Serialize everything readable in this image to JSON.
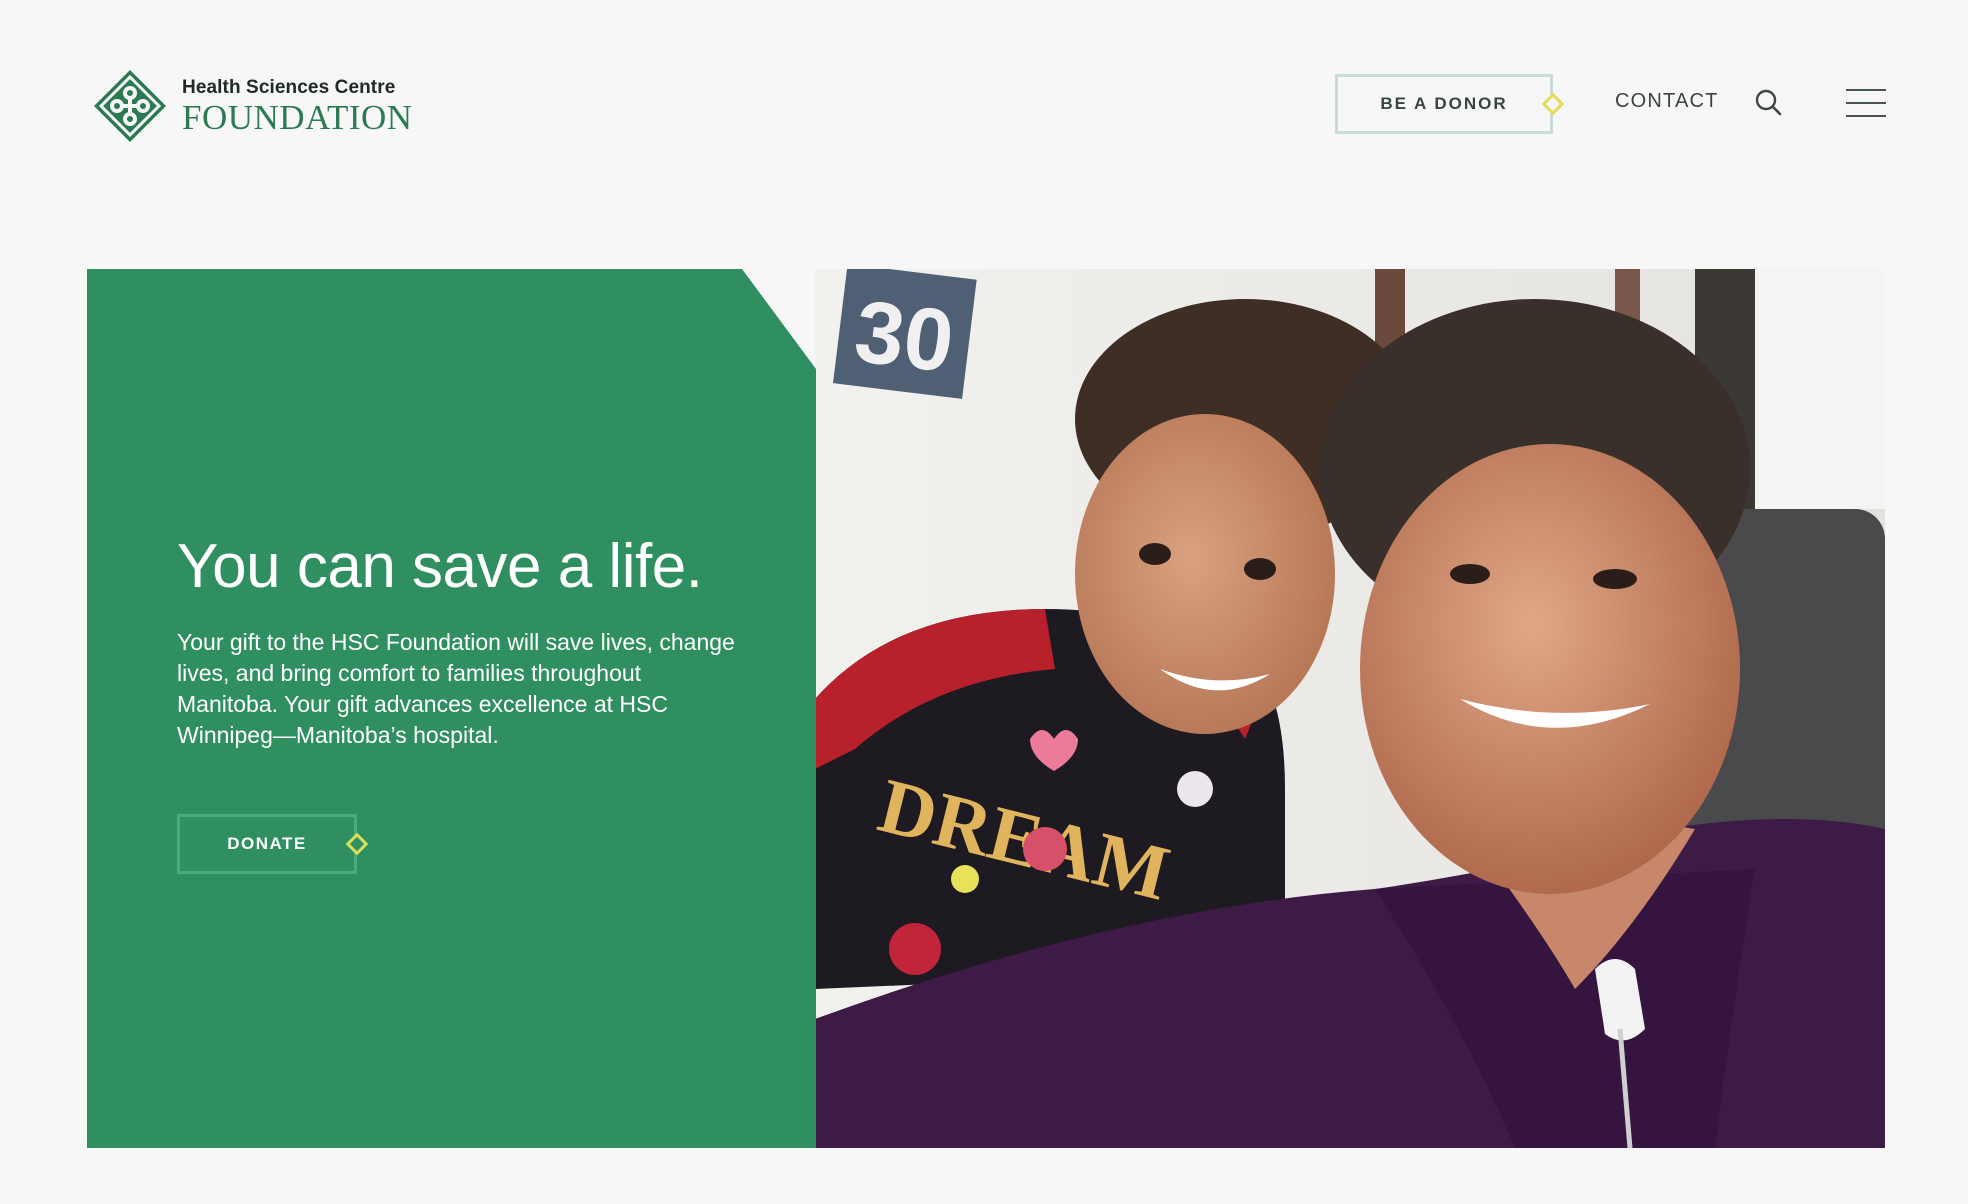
{
  "logo": {
    "line1": "Health Sciences Centre",
    "line2": "FOUNDATION",
    "icon": "hsc-foundation-logo-icon"
  },
  "nav": {
    "be_a_donor": "BE A DONOR",
    "contact": "CONTACT",
    "search_icon": "search-icon",
    "menu_icon": "hamburger-menu-icon"
  },
  "hero": {
    "heading": "You can save a life.",
    "body": "Your gift to the HSC Foundation will save lives, change lives, and bring comfort to families throughout Manitoba. Your gift advances excellence at HSC Winnipeg—Manitoba’s hospital.",
    "donate_label": "DONATE",
    "photo": {
      "number_sign": "30",
      "shirt_text": "DREAM"
    }
  },
  "colors": {
    "background": "#f7f7f7",
    "brand_green": "#308f61",
    "logo_green": "#2c7a52",
    "accent_yellow": "#e2dd57",
    "button_border": "#c9dcd5"
  }
}
